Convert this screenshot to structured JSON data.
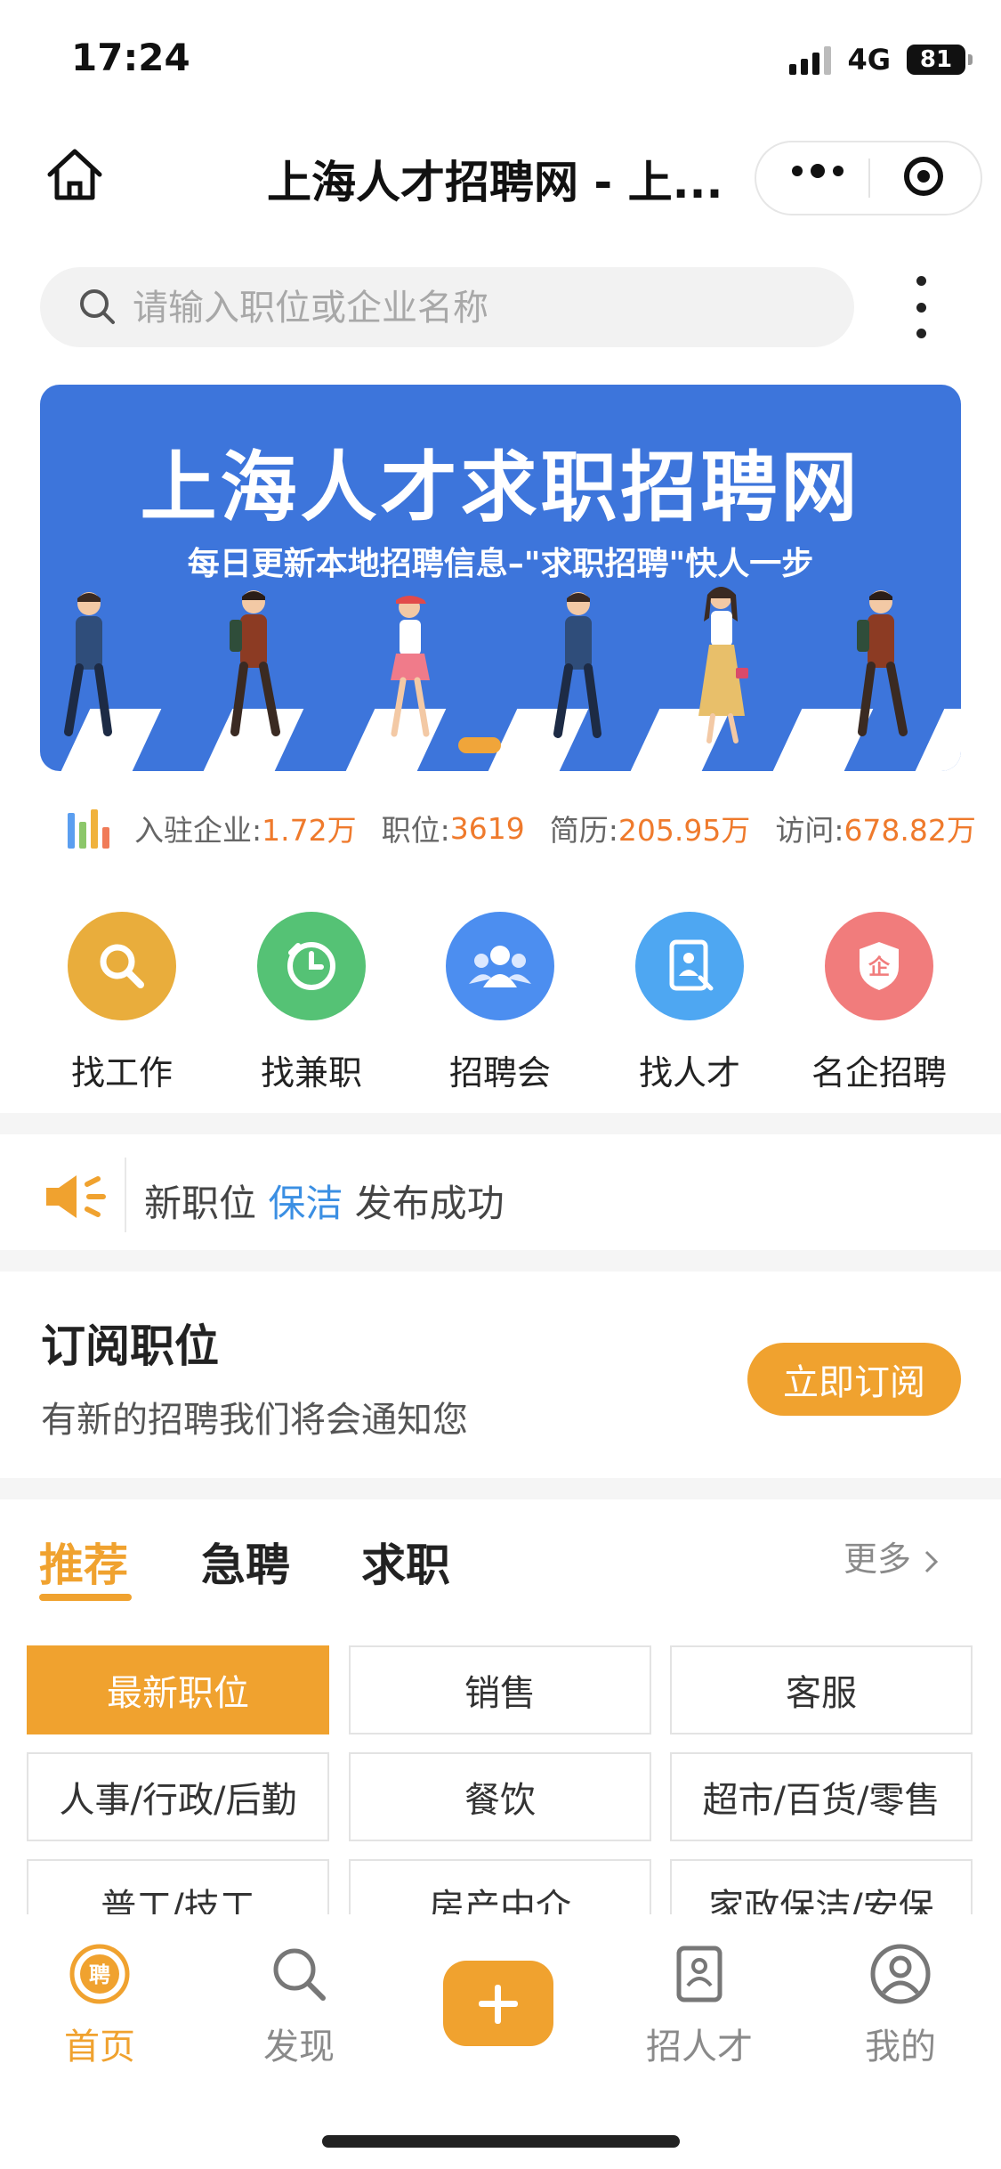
{
  "status_bar": {
    "time": "17:24",
    "network": "4G",
    "battery": "81"
  },
  "nav": {
    "title": "上海人才招聘网 - 上..."
  },
  "search": {
    "placeholder": "请输入职位或企业名称"
  },
  "banner": {
    "title": "上海人才求职招聘网",
    "subtitle": "每日更新本地招聘信息–\"求职招聘\"快人一步"
  },
  "stats": [
    {
      "label": "入驻企业:",
      "value": "1.72万"
    },
    {
      "label": "职位:",
      "value": "3619"
    },
    {
      "label": "简历:",
      "value": "205.95万"
    },
    {
      "label": "访问:",
      "value": "678.82万"
    }
  ],
  "quick_nav": [
    {
      "label": "找工作",
      "color": "#e9ad3c",
      "icon": "search-icon"
    },
    {
      "label": "找兼职",
      "color": "#55c275",
      "icon": "clock-icon"
    },
    {
      "label": "招聘会",
      "color": "#4c8ef0",
      "icon": "group-icon"
    },
    {
      "label": "找人才",
      "color": "#4ea7f2",
      "icon": "resume-icon"
    },
    {
      "label": "名企招聘",
      "color": "#f17c7c",
      "icon": "enterprise-badge-icon"
    }
  ],
  "notice": {
    "prefix": "新职位 ",
    "highlight": "保洁",
    "suffix": " 发布成功"
  },
  "subscribe": {
    "title": "订阅职位",
    "desc": "有新的招聘我们将会通知您",
    "button": "立即订阅"
  },
  "tabs": {
    "items": [
      "推荐",
      "急聘",
      "求职"
    ],
    "active": 0,
    "more": "更多"
  },
  "categories": [
    "最新职位",
    "销售",
    "客服",
    "人事/行政/后勤",
    "餐饮",
    "超市/百货/零售",
    "普工/技工",
    "房产中介",
    "家政保洁/安保"
  ],
  "tabbar": [
    {
      "label": "首页",
      "icon": "home-hire-icon",
      "active": true
    },
    {
      "label": "发现",
      "icon": "search-icon",
      "active": false
    },
    {
      "label": "",
      "icon": "plus-icon",
      "active": false
    },
    {
      "label": "招人才",
      "icon": "resume-icon",
      "active": false
    },
    {
      "label": "我的",
      "icon": "user-icon",
      "active": false
    }
  ],
  "colors": {
    "accent": "#f0a22f",
    "banner_bg": "#3d75db",
    "stat_value": "#ef7a2c",
    "notice_highlight": "#3b8fe3"
  }
}
